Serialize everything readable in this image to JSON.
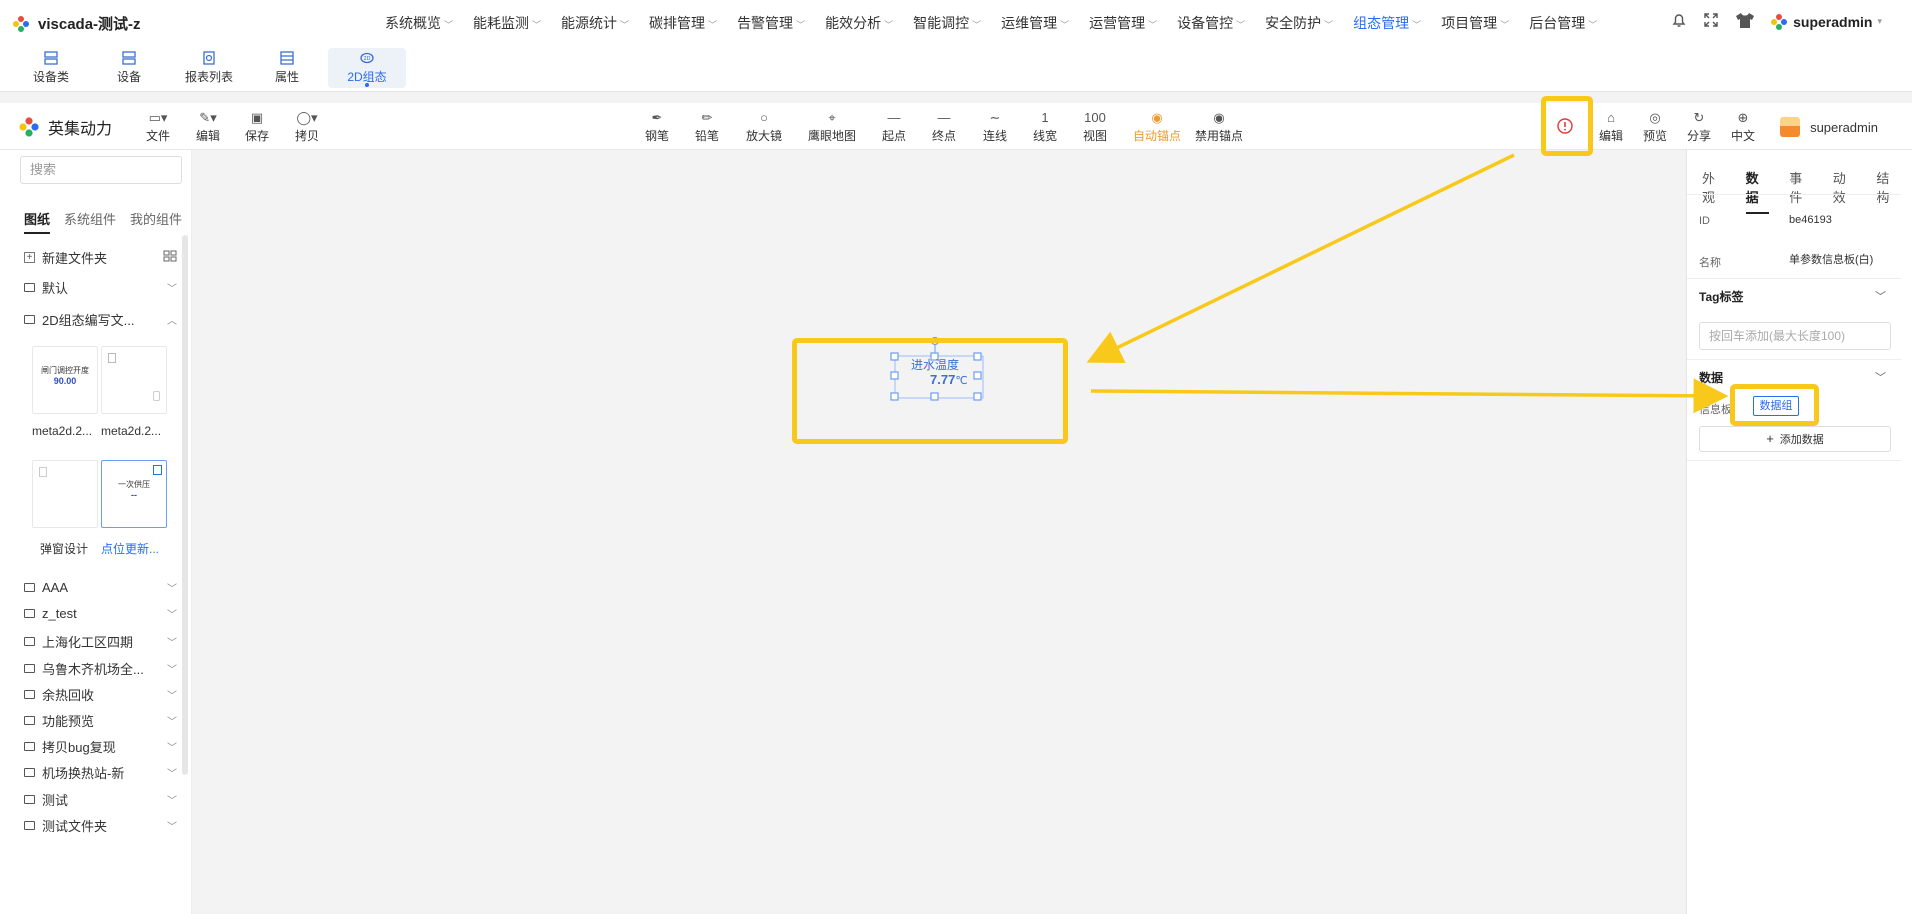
{
  "app": {
    "title": "viscada-测试-z",
    "user": "superadmin"
  },
  "menu": [
    {
      "label": "系统概览"
    },
    {
      "label": "能耗监测"
    },
    {
      "label": "能源统计"
    },
    {
      "label": "碳排管理"
    },
    {
      "label": "告警管理"
    },
    {
      "label": "能效分析"
    },
    {
      "label": "智能调控"
    },
    {
      "label": "运维管理"
    },
    {
      "label": "运营管理"
    },
    {
      "label": "设备管控"
    },
    {
      "label": "安全防护"
    },
    {
      "label": "组态管理"
    },
    {
      "label": "项目管理"
    },
    {
      "label": "后台管理"
    }
  ],
  "active_menu": "组态管理",
  "subtabs": [
    {
      "label": "设备类"
    },
    {
      "label": "设备"
    },
    {
      "label": "报表列表"
    },
    {
      "label": "属性"
    },
    {
      "label": "2D组态"
    }
  ],
  "editor": {
    "brand": "英集动力",
    "file_tools": [
      {
        "label": "文件"
      },
      {
        "label": "编辑"
      },
      {
        "label": "保存"
      },
      {
        "label": "拷贝"
      }
    ],
    "draw_tools": [
      {
        "label": "钢笔"
      },
      {
        "label": "铅笔"
      },
      {
        "label": "放大镜"
      },
      {
        "label": "鹰眼地图"
      },
      {
        "label": "起点"
      },
      {
        "label": "终点"
      },
      {
        "label": "连线"
      },
      {
        "label": "线宽",
        "value": "1"
      },
      {
        "label": "视图",
        "value": "100"
      },
      {
        "label": "自动锚点"
      },
      {
        "label": "禁用锚点"
      }
    ],
    "right_tools": [
      {
        "label": "编辑"
      },
      {
        "label": "预览"
      },
      {
        "label": "分享"
      },
      {
        "label": "中文"
      }
    ],
    "user": "superadmin"
  },
  "left": {
    "search_placeholder": "搜索",
    "tabs": [
      {
        "label": "图纸"
      },
      {
        "label": "系统组件"
      },
      {
        "label": "我的组件"
      }
    ],
    "new_folder": "新建文件夹",
    "folders_top": [
      {
        "label": "默认"
      },
      {
        "label": "2D组态编写文..."
      }
    ],
    "thumbs": [
      {
        "label": "meta2d.2...",
        "preview_title": "闸门调控开度",
        "preview_value": "90.00"
      },
      {
        "label": "meta2d.2..."
      },
      {
        "label": "弹窗设计"
      },
      {
        "label": "点位更新...",
        "preview_title": "一次供压",
        "preview_value": "--"
      }
    ],
    "folders": [
      {
        "label": "AAA"
      },
      {
        "label": "z_test"
      },
      {
        "label": "上海化工区四期"
      },
      {
        "label": "乌鲁木齐机场全..."
      },
      {
        "label": "余热回收"
      },
      {
        "label": "功能预览"
      },
      {
        "label": "拷贝bug复现"
      },
      {
        "label": "机场换热站-新"
      },
      {
        "label": "测试"
      },
      {
        "label": "测试文件夹"
      }
    ]
  },
  "canvas": {
    "widget_title": "进水温度",
    "widget_value": "7.77",
    "widget_unit": "℃"
  },
  "right": {
    "tabs": [
      {
        "label": "外观"
      },
      {
        "label": "数据"
      },
      {
        "label": "事件"
      },
      {
        "label": "动效"
      },
      {
        "label": "结构"
      }
    ],
    "id_label": "ID",
    "id_value": "be46193",
    "name_label": "名称",
    "name_value": "单参数信息板(白)",
    "tag_header": "Tag标签",
    "tag_placeholder": "按回车添加(最大长度100)",
    "data_header": "数据",
    "info_label": "信息板",
    "data_group_btn": "数据组",
    "add_data_btn": "添加数据"
  },
  "colors": {
    "accent": "#2a6cf0",
    "highlight": "#f8c91a",
    "warning": "#e53935",
    "auto_anchor": "#f29a2e"
  }
}
